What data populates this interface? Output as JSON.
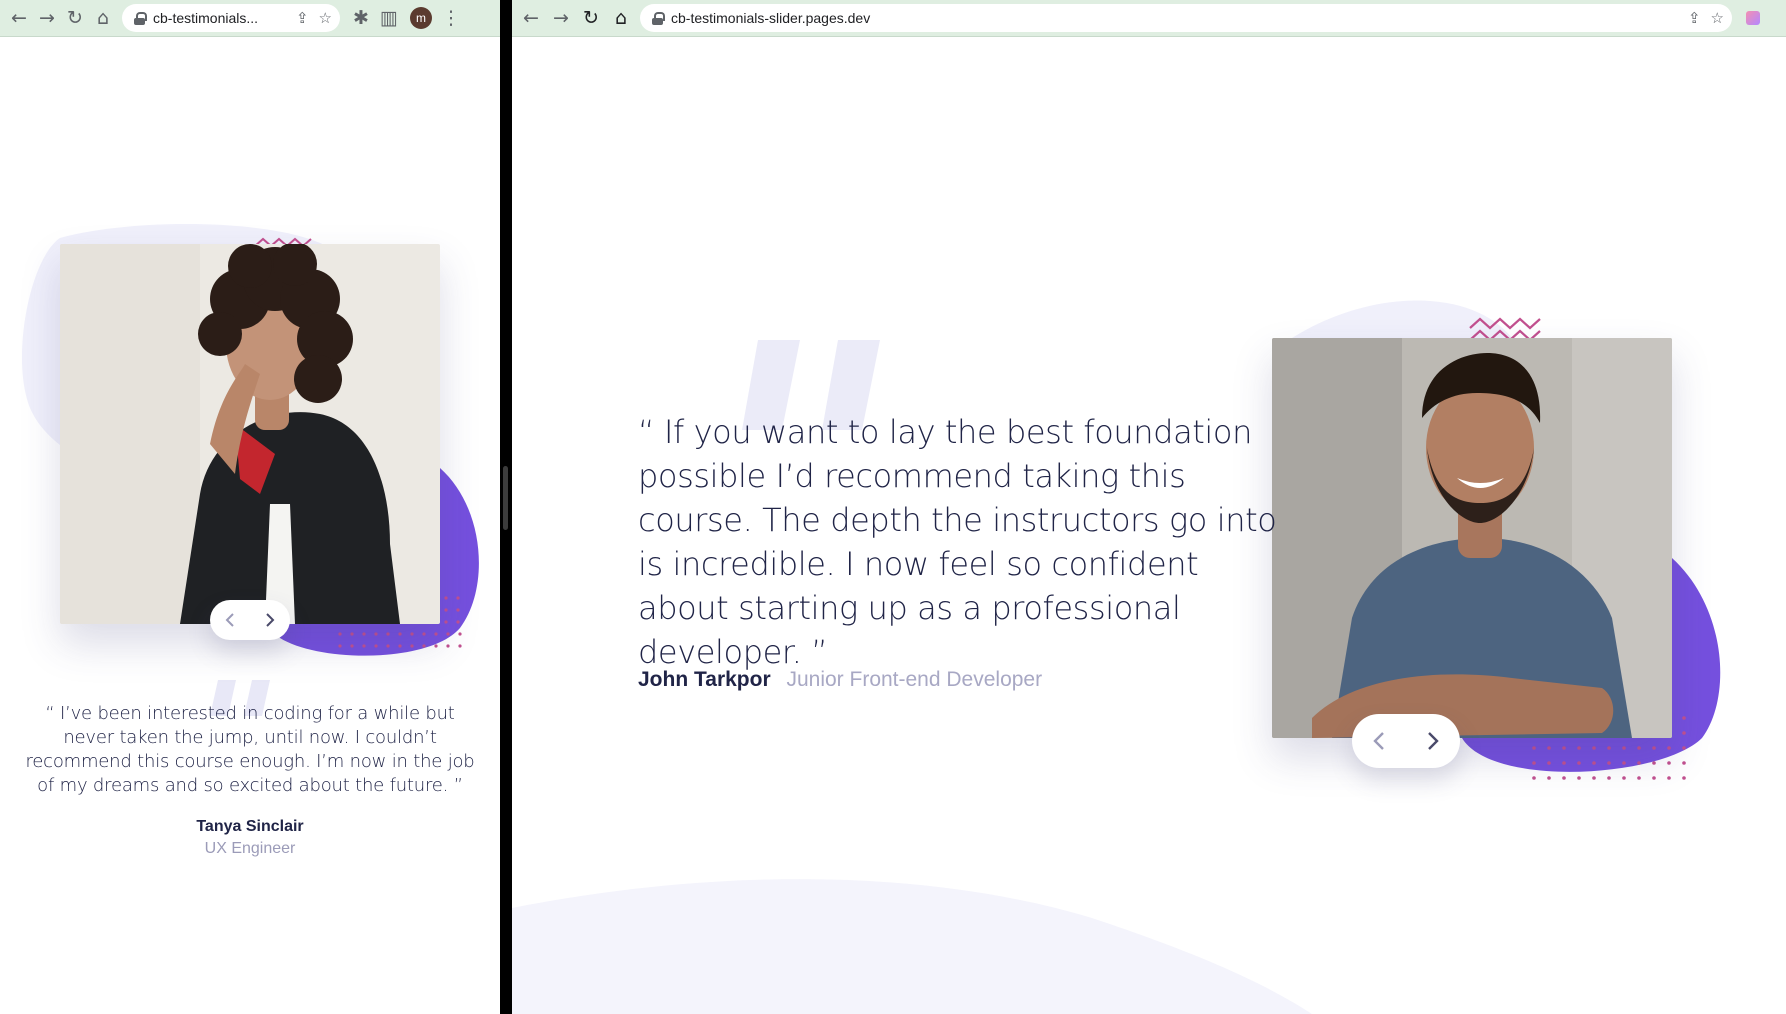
{
  "left_window": {
    "url": "cb-testimonials...",
    "avatar_initial": "m",
    "testimonial": {
      "quote": "“ I’ve been interested in coding for a while but never taken the jump, until now. I couldn’t recommend this course enough. I’m now in the job of my dreams and so excited about the future. ”",
      "name": "Tanya Sinclair",
      "role": "UX Engineer"
    }
  },
  "right_window": {
    "url": "cb-testimonials-slider.pages.dev",
    "testimonial": {
      "quote": "“ If you want to lay the best foundation possible I’d recommend taking this course. The depth the instructors go into is incredible. I now feel so confident about starting up as a professional developer. ”",
      "name": "John Tarkpor",
      "role": "Junior Front-end Developer"
    }
  },
  "icons": {
    "back": "arrow-left-icon",
    "forward": "arrow-right-icon",
    "reload": "reload-icon",
    "home": "home-icon",
    "lock": "lock-icon",
    "share": "share-icon",
    "bookmark": "star-icon",
    "extensions": "puzzle-icon",
    "side_panel": "side-panel-icon",
    "menu": "more-vert-icon",
    "prev": "chevron-left-icon",
    "next": "chevron-right-icon"
  },
  "colors": {
    "text_dark": "#202447",
    "text_muted": "#9b9bb8",
    "accent_purple": "#6c4ce0",
    "accent_pink": "#c2508f",
    "bg_blob": "#eeeefb",
    "toolbar": "#dfeee1"
  }
}
